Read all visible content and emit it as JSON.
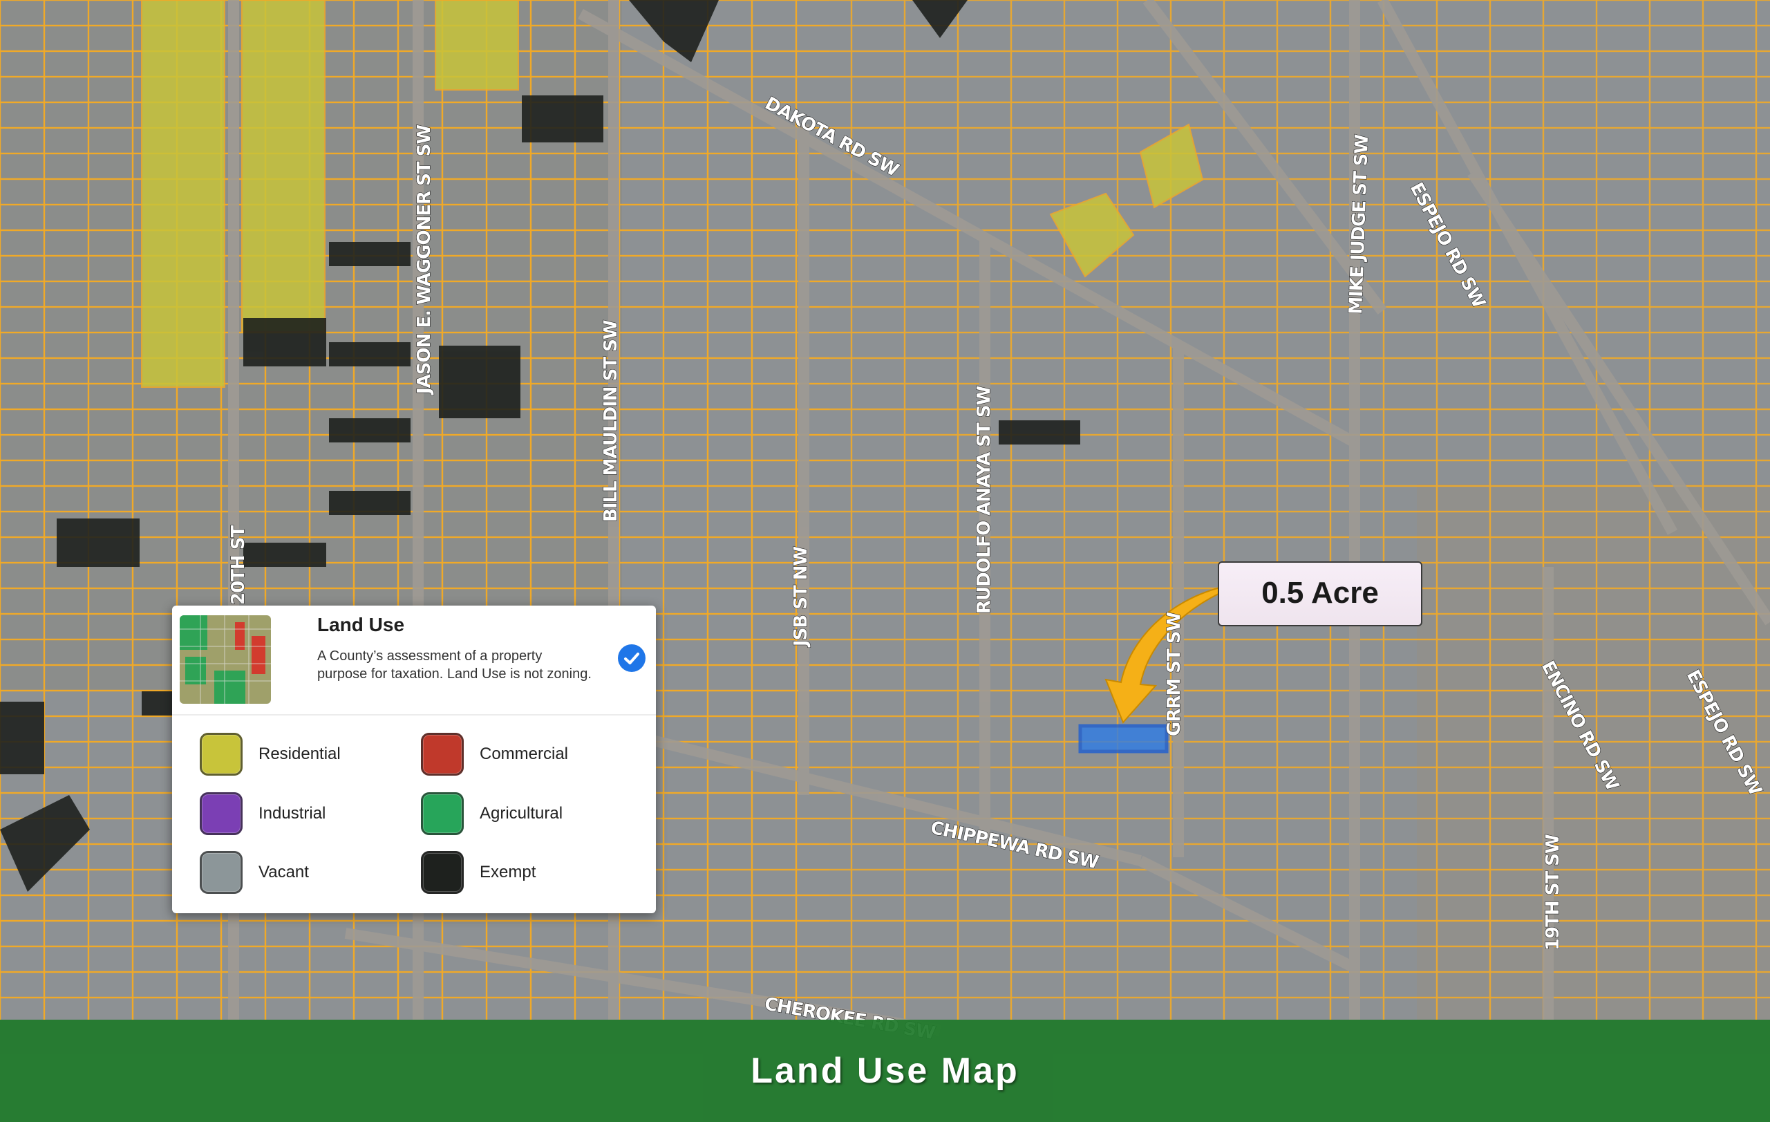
{
  "colors": {
    "parcel_outline": "#f0a928",
    "residential": "#c8c43a",
    "commercial": "#c0392b",
    "industrial": "#7b3fb4",
    "agricultural": "#27a55a",
    "vacant": "#8c9699",
    "exempt": "#1e211e",
    "subject_parcel": "#2f7ce6",
    "arrow": "#f5b017",
    "footer": "#1f7a2b"
  },
  "streets": {
    "dakota": "DAKOTA RD SW",
    "waggoner": "JASON E. WAGGONER ST SW",
    "mauldin": "BILL MAULDIN ST SW",
    "jsb": "JSB ST NW",
    "anaya": "RUDOLFO ANAYA ST SW",
    "mike_judge": "MIKE JUDGE ST SW",
    "espejo_1": "ESPEJO RD SW",
    "espejo_2": "ESPEJO RD SW",
    "encino": "ENCINO RD SW",
    "chippewa": "CHIPPEWA RD SW",
    "cherokee": "CHEROKEE RD SW",
    "nineteenth": "19TH ST SW",
    "twentieth": "20TH ST",
    "grrm": "GRRM ST SW"
  },
  "legend": {
    "title": "Land Use",
    "description": "A County’s assessment of a property purpose for taxation. Land Use is not zoning.",
    "items": [
      {
        "label": "Residential",
        "color": "#c8c43a"
      },
      {
        "label": "Commercial",
        "color": "#c0392b"
      },
      {
        "label": "Industrial",
        "color": "#7b3fb4"
      },
      {
        "label": "Agricultural",
        "color": "#27a55a"
      },
      {
        "label": "Vacant",
        "color": "#8c9699"
      },
      {
        "label": "Exempt",
        "color": "#1e211e"
      }
    ]
  },
  "callout": {
    "text": "0.5 Acre"
  },
  "footer": {
    "title": "Land Use Map"
  }
}
